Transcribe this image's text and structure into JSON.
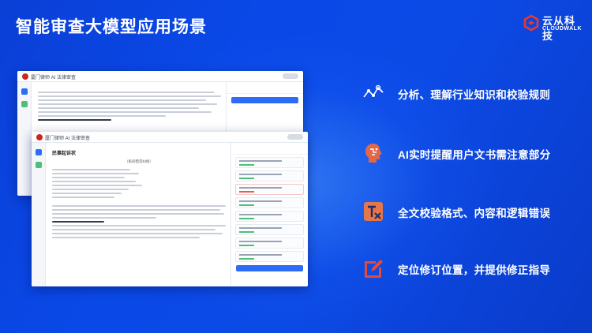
{
  "slide": {
    "title": "智能审查大模型应用场景"
  },
  "logo": {
    "name_cn": "云从科技",
    "name_en": "CLOUDWALK",
    "accent": "#e8392f"
  },
  "screens": {
    "back": {
      "app_title": "厦门律师 AI 法律审查"
    },
    "front": {
      "app_title": "厦门律师 AI 法律审查",
      "doc_title": "民事起诉状",
      "doc_subtitle": "（民间借贷纠纷）"
    }
  },
  "features": [
    {
      "icon": "analysis-icon",
      "text": "分析、理解行业知识和校验规则",
      "color": "#ffffff"
    },
    {
      "icon": "ai-alert-icon",
      "text": "AI实时提醒用户文书需注意部分",
      "color": "#e2674a"
    },
    {
      "icon": "proofread-icon",
      "text": "全文校验格式、内容和逻辑错误",
      "color": "#e5764a"
    },
    {
      "icon": "edit-locate-icon",
      "text": "定位修订位置，并提供修正指导",
      "color": "#e34a3a"
    }
  ]
}
